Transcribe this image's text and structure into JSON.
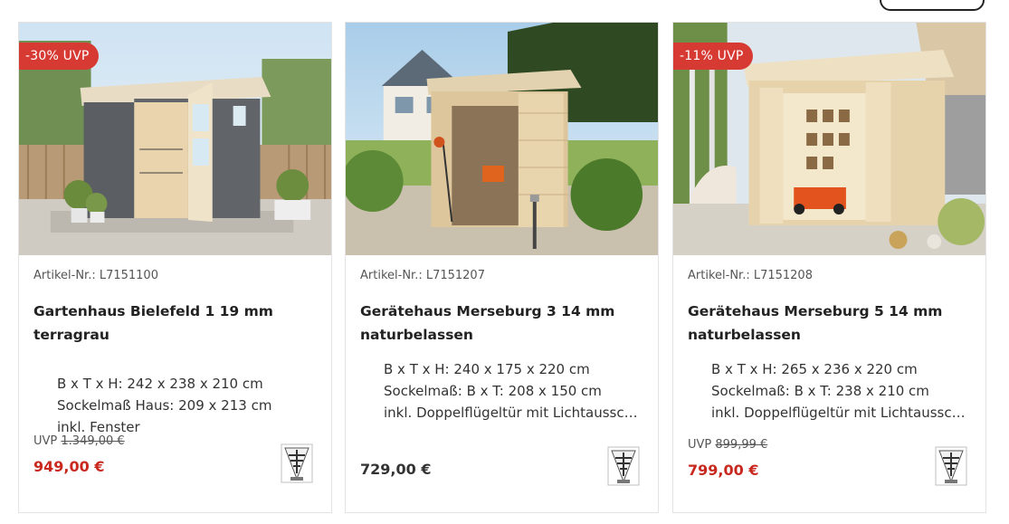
{
  "colors": {
    "badge": "#d63a33",
    "sale_price": "#c8281e",
    "regular_price": "#333333",
    "card_border": "#e3e3e3"
  },
  "products": [
    {
      "badge": "-30% UVP",
      "sku": "Artikel-Nr.: L7151100",
      "title": "Gartenhaus Bielefeld 1 19 mm terragrau",
      "specs": [
        "B x T x H: 242 x 238 x 210 cm",
        "Sockelmaß Haus: 209 x 213 cm",
        "inkl. Fenster"
      ],
      "uvp_label": "UVP",
      "uvp_old": "1.349,00 €",
      "price": "949,00 €",
      "image_icon": "garden-shed-grey-image",
      "brand_icon": "karibu-logo-icon"
    },
    {
      "badge": "",
      "sku": "Artikel-Nr.: L7151207",
      "title": "Gerätehaus Merseburg 3 14 mm naturbelassen",
      "specs": [
        "B x T x H: 240 x 175 x 220 cm",
        "Sockelmaß: B x T: 208 x 150 cm",
        "inkl. Doppelflügeltür mit Lichtausschnitt"
      ],
      "uvp_label": "",
      "uvp_old": "",
      "price": "729,00 €",
      "image_icon": "tool-shed-natural-image",
      "brand_icon": "karibu-logo-icon"
    },
    {
      "badge": "-11% UVP",
      "sku": "Artikel-Nr.: L7151208",
      "title": "Gerätehaus Merseburg 5 14 mm naturbelassen",
      "specs": [
        "B x T x H: 265 x 236 x 220 cm",
        "Sockelmaß: B x T: 238 x 210 cm",
        "inkl. Doppelflügeltür mit Lichtausschnitt"
      ],
      "uvp_label": "UVP",
      "uvp_old": "899,99 €",
      "price": "799,00 €",
      "image_icon": "tool-shed-natural-large-image",
      "brand_icon": "karibu-logo-icon"
    }
  ]
}
